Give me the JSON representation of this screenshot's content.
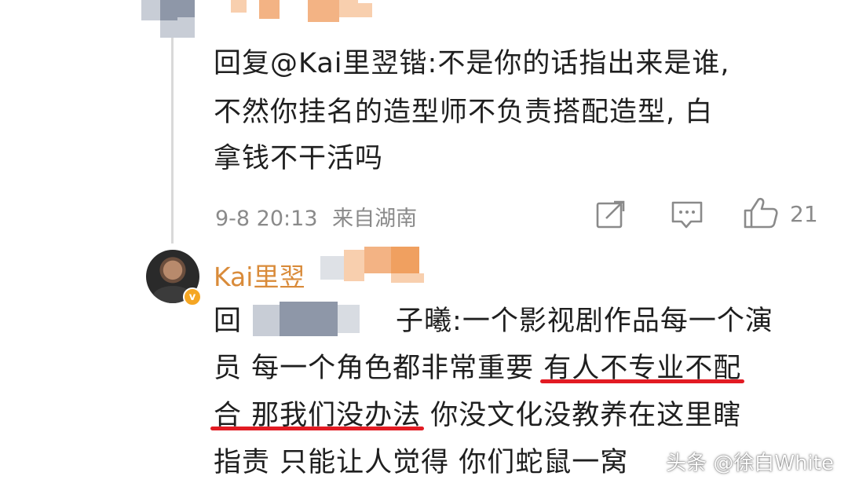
{
  "comment1": {
    "reply_prefix": "回复",
    "mention": "@Kai里翌锴",
    "line1_rest": ":不是你的话指出来是谁,",
    "line2": "不然你挂名的造型师不负责搭配造型, 白",
    "line3": "拿钱不干活吗",
    "time": "9-8 20:13",
    "location": "来自湖南",
    "like_count": "21"
  },
  "comment2": {
    "username_visible": "Kai里翌",
    "reply_prefix": "回",
    "reply_name_tail": "子曦",
    "line1_rest": ":一个影视剧作品每一个演",
    "line2_a": "员 每一个角色都非常重要",
    "line2_highlight": "有人不专业不配",
    "line3_highlight": "合 那我们没办法",
    "line3_b": "你没文化没教养在这里瞎",
    "line4": "指责 只能让人觉得 你们蛇鼠一窝",
    "avatar_icon": "user-avatar",
    "verified_icon": "verified-badge"
  },
  "watermark": {
    "text": "头条 @徐白White"
  },
  "colors": {
    "underline": "#e21b23",
    "username": "#d98b3a",
    "meta": "#8a8a8a"
  }
}
